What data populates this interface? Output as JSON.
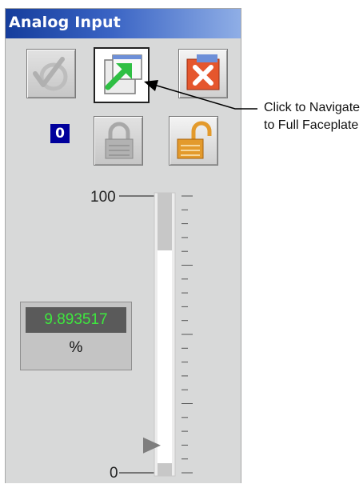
{
  "window": {
    "title": "Analog Input"
  },
  "toolbar": {
    "acknowledge_icon": "check-arrow-icon",
    "navigate_icon": "navigate-to-faceplate-icon",
    "close_icon": "close-x-icon",
    "lock_icon": "padlock-closed-icon",
    "unlock_icon": "padlock-open-icon"
  },
  "mode_indicator": {
    "value": "0"
  },
  "scale": {
    "max_label": "100",
    "min_label": "0",
    "min": 0,
    "max": 100
  },
  "process_value": {
    "value": "9.893517",
    "units": "%"
  },
  "annotation": {
    "line1": "Click to Navigate",
    "line2": "to Full Faceplate"
  },
  "colors": {
    "title_gradient_start": "#153d9c",
    "title_gradient_end": "#8faee6",
    "pv_text": "#3ee83e",
    "close_button": "#e5562d",
    "navigate_arrow": "#2fbf44",
    "unlock_button": "#e39a2c",
    "mode_badge": "#00009c"
  }
}
